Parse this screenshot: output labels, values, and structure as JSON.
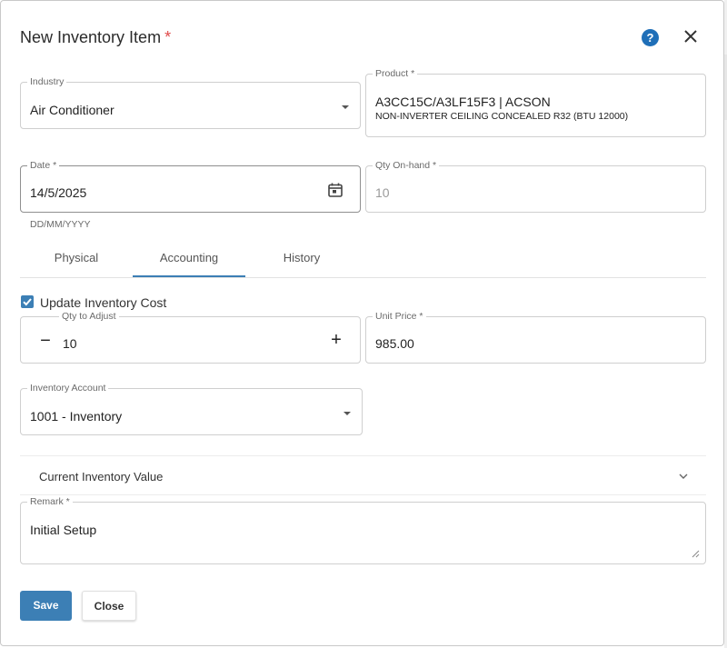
{
  "dialog": {
    "title": "New Inventory Item",
    "required_marker": "*"
  },
  "industry": {
    "label": "Industry",
    "value": "Air Conditioner"
  },
  "product": {
    "label": "Product *",
    "value": "A3CC15C/A3LF15F3 | ACSON",
    "description": "NON-INVERTER CEILING CONCEALED R32 (BTU 12000)"
  },
  "date": {
    "label": "Date *",
    "value": "14/5/2025",
    "hint": "DD/MM/YYYY"
  },
  "qty_on_hand": {
    "label": "Qty On-hand *",
    "value": "10"
  },
  "tabs": [
    {
      "label": "Physical"
    },
    {
      "label": "Accounting",
      "active": true
    },
    {
      "label": "History"
    }
  ],
  "update_cost": {
    "label": "Update Inventory Cost",
    "checked": true
  },
  "qty_adjust": {
    "label": "Qty to Adjust",
    "value": "10"
  },
  "unit_price": {
    "label": "Unit Price *",
    "value": "985.00"
  },
  "inventory_account": {
    "label": "Inventory Account",
    "value": "1001 - Inventory"
  },
  "current_value": {
    "label": "Current Inventory Value"
  },
  "remark": {
    "label": "Remark *",
    "value": "Initial Setup"
  },
  "buttons": {
    "save": "Save",
    "close": "Close"
  },
  "colors": {
    "primary": "#3c7fb5",
    "help_icon": "#1f6fb8",
    "required": "#e04a4a"
  },
  "icons": {
    "help": "help-circle-icon",
    "close": "close-icon",
    "calendar": "calendar-icon",
    "dropdown": "caret-down-icon",
    "expand": "chevron-down-icon",
    "check": "checkbox-checked-icon",
    "minus": "minus-icon",
    "plus": "plus-icon"
  }
}
